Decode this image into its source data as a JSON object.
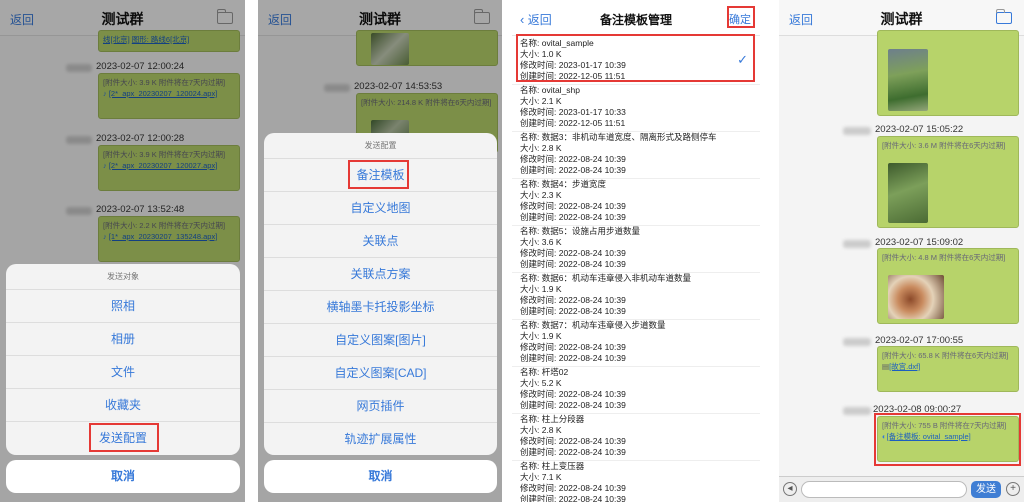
{
  "panel1": {
    "back": "返回",
    "title": "测试群",
    "top_bubble": {
      "text": "线[北京]",
      "text2": "图形: 路线6[北京]"
    },
    "messages": [
      {
        "time": "2023-02-07 12:00:24",
        "size": "[附件大小: 3.9 K 附件将在7天内过期]",
        "link": "[2*_apx_20230207_120024.apx]"
      },
      {
        "time": "2023-02-07 12:00:28",
        "size": "[附件大小: 3.9 K 附件将在7天内过期]",
        "link": "[2*_apx_20230207_120027.apx]"
      },
      {
        "time": "2023-02-07 13:52:48",
        "size": "[附件大小: 2.2 K 附件将在7天内过期]",
        "link": "[1*_apx_20230207_135248.apx]"
      }
    ],
    "sheet": {
      "caption": "发送对象",
      "items": [
        "照相",
        "相册",
        "文件",
        "收藏夹",
        "发送配置"
      ],
      "cancel": "取消"
    }
  },
  "panel2": {
    "back": "返回",
    "title": "测试群",
    "messages": [
      {
        "time": "2023-02-07 14:53:53",
        "size": "[附件大小: 214.8 K 附件将在6天内过期]"
      }
    ],
    "sheet": {
      "caption": "发送配置",
      "items": [
        "备注模板",
        "自定义地图",
        "关联点",
        "关联点方案",
        "横轴墨卡托投影坐标",
        "自定义图案[图片]",
        "自定义图案[CAD]",
        "网页插件",
        "轨迹扩展属性"
      ],
      "cancel": "取消"
    }
  },
  "panel3": {
    "back": "返回",
    "title": "备注模板管理",
    "confirm": "确定",
    "templates": [
      {
        "name": "名称: ovital_sample",
        "size": "大小: 1.0 K",
        "mtime": "修改时间: 2023-01-17 10:39",
        "ctime": "创建时间: 2022-12-05 11:51"
      },
      {
        "name": "名称: ovital_shp",
        "size": "大小: 2.1 K",
        "mtime": "修改时间: 2023-01-17 10:33",
        "ctime": "创建时间: 2022-12-05 11:51"
      },
      {
        "name": "名称: 数据3：非机动车道宽度、隔离形式及路侧停车",
        "size": "大小: 2.8 K",
        "mtime": "修改时间: 2022-08-24 10:39",
        "ctime": "创建时间: 2022-08-24 10:39"
      },
      {
        "name": "名称: 数据4：步道宽度",
        "size": "大小: 2.3 K",
        "mtime": "修改时间: 2022-08-24 10:39",
        "ctime": "创建时间: 2022-08-24 10:39"
      },
      {
        "name": "名称: 数据5：设施占用步道数量",
        "size": "大小: 3.6 K",
        "mtime": "修改时间: 2022-08-24 10:39",
        "ctime": "创建时间: 2022-08-24 10:39"
      },
      {
        "name": "名称: 数据6：机动车违章侵入非机动车道数量",
        "size": "大小: 1.9 K",
        "mtime": "修改时间: 2022-08-24 10:39",
        "ctime": "创建时间: 2022-08-24 10:39"
      },
      {
        "name": "名称: 数据7：机动车违章侵入步道数量",
        "size": "大小: 1.9 K",
        "mtime": "修改时间: 2022-08-24 10:39",
        "ctime": "创建时间: 2022-08-24 10:39"
      },
      {
        "name": "名称: 杆塔02",
        "size": "大小: 5.2 K",
        "mtime": "修改时间: 2022-08-24 10:39",
        "ctime": "创建时间: 2022-08-24 10:39"
      },
      {
        "name": "名称: 柱上分段器",
        "size": "大小: 2.8 K",
        "mtime": "修改时间: 2022-08-24 10:39",
        "ctime": "创建时间: 2022-08-24 10:39"
      },
      {
        "name": "名称: 柱上变压器",
        "size": "大小: 7.1 K",
        "mtime": "修改时间: 2022-08-24 10:39",
        "ctime": "创建时间: 2022-08-24 10:39"
      }
    ]
  },
  "panel4": {
    "back": "返回",
    "title": "测试群",
    "messages": [
      {
        "time": "2023-02-07 15:05:22",
        "size": "[附件大小: 3.6 M 附件将在6天内过期]"
      },
      {
        "time": "2023-02-07 15:09:02",
        "size": "[附件大小: 4.8 M 附件将在6天内过期]"
      },
      {
        "time": "2023-02-07 17:00:55",
        "size": "[附件大小: 65.8 K 附件将在6天内过期]",
        "link": "[故宫.dxf]"
      },
      {
        "time": "2023-02-08 09:00:27",
        "size": "[附件大小: 755 B 附件将在7天内过期]",
        "link": "[备注模板: ovital_sample]"
      }
    ],
    "send": "发送"
  }
}
